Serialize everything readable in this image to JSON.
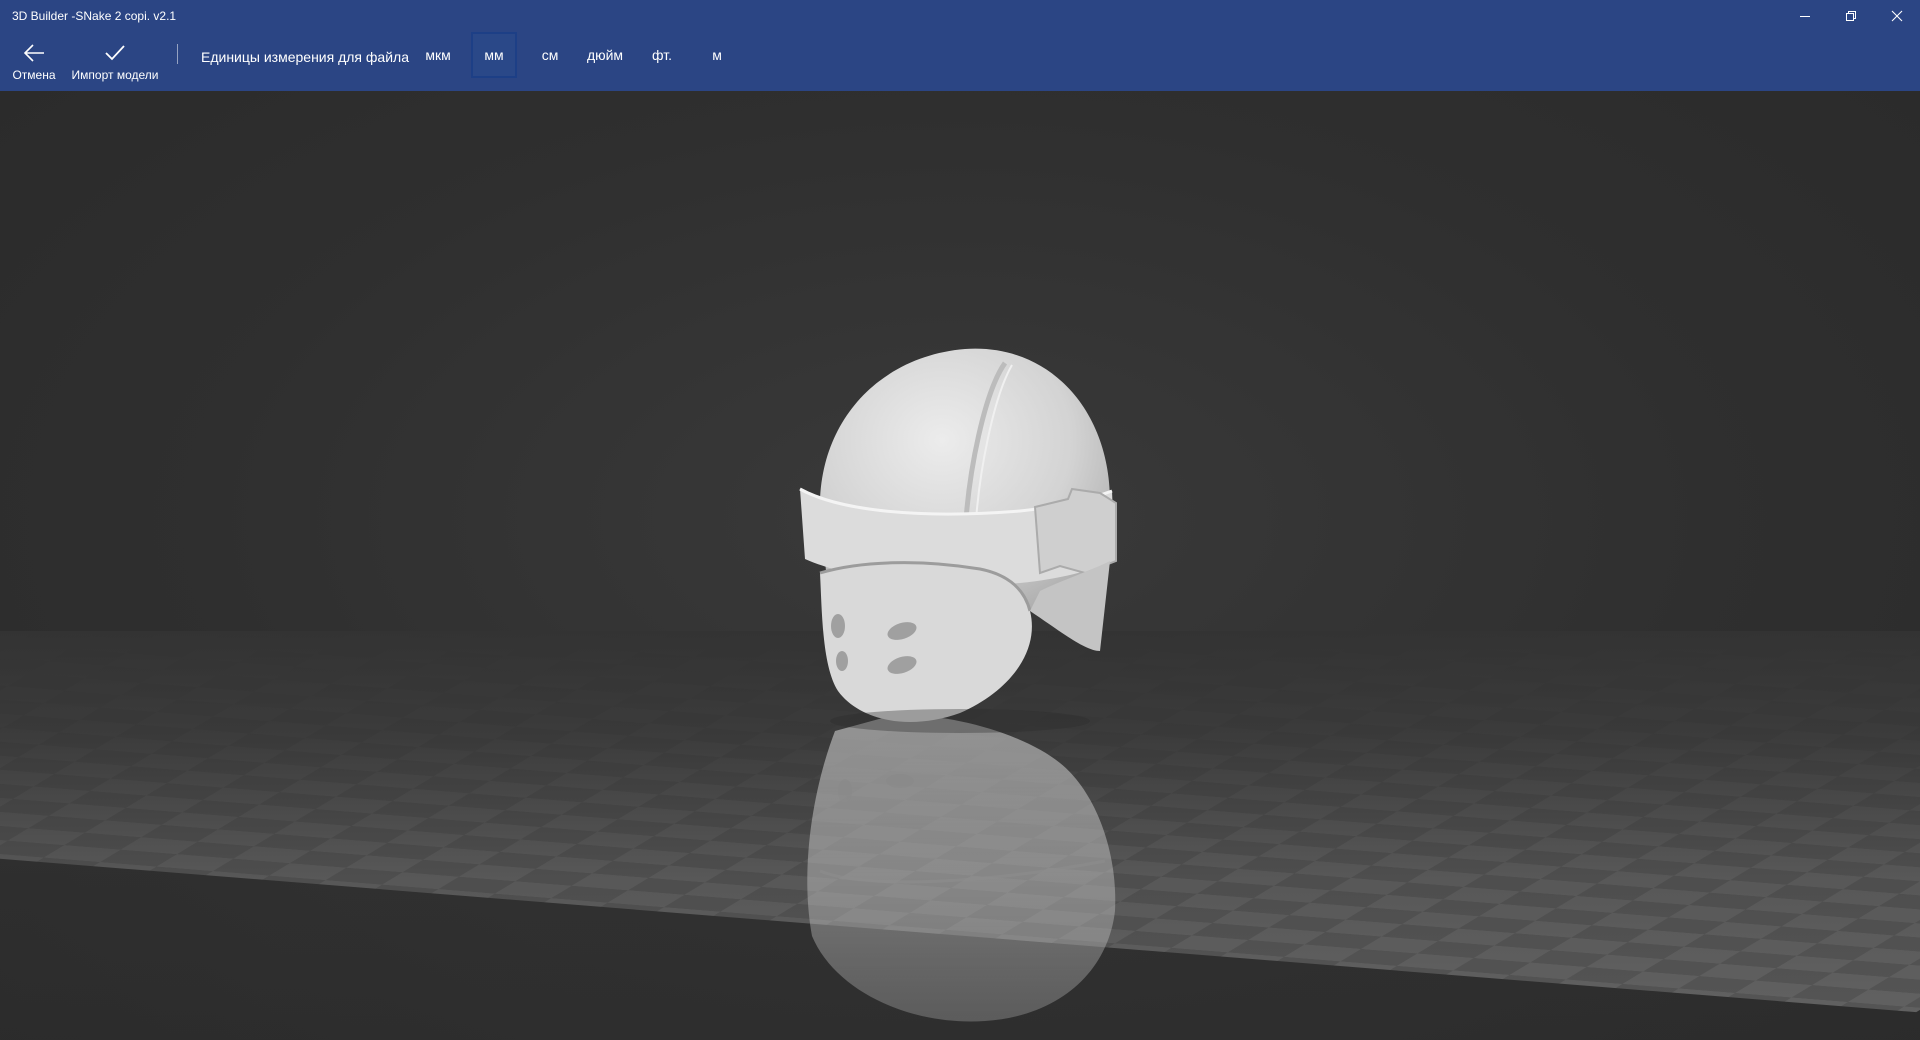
{
  "window": {
    "title": "3D Builder -SNake 2 copi. v2.1",
    "controls": [
      "minimize",
      "restore",
      "close"
    ]
  },
  "toolbar": {
    "cancel": {
      "label": "Отмена",
      "icon": "arrow-left-icon"
    },
    "import": {
      "label": "Импорт модели",
      "icon": "checkmark-icon"
    },
    "units_label": "Единицы измерения для файла",
    "units": [
      "мкм",
      "мм",
      "см",
      "дюйм",
      "фт.",
      "м"
    ],
    "selected_unit": "мм"
  },
  "colors": {
    "titlebar": "#2b4584",
    "viewport": "#333333",
    "model": "#d6d6d6"
  }
}
